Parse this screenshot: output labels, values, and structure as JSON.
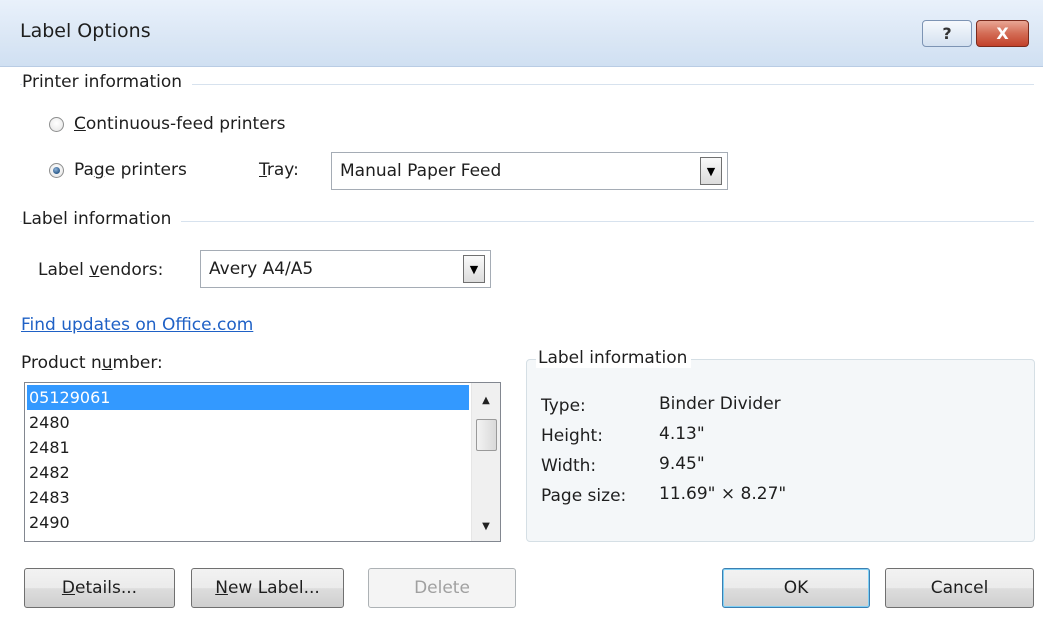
{
  "window": {
    "title": "Label Options",
    "help_label": "?",
    "close_label": "X"
  },
  "printer_info": {
    "heading": "Printer information",
    "continuous": {
      "pre": "",
      "key": "C",
      "post": "ontinuous-feed printers",
      "checked": false
    },
    "page": {
      "pre": "Pa",
      "key": "g",
      "post": "e printers",
      "checked": true
    },
    "tray_label": {
      "pre": "",
      "key": "T",
      "post": "ray:"
    },
    "tray_value": "Manual Paper Feed"
  },
  "label_info": {
    "heading": "Label information",
    "vendors_label": {
      "pre": "Label ",
      "key": "v",
      "post": "endors:"
    },
    "vendors_value": "Avery A4/A5"
  },
  "link": {
    "text": "Find updates on Office.com"
  },
  "product": {
    "label": {
      "pre": "Product n",
      "key": "u",
      "post": "mber:"
    },
    "items": [
      "05129061",
      "2480",
      "2481",
      "2482",
      "2483",
      "2490"
    ],
    "selected_index": 0
  },
  "details_box": {
    "legend": "Label information",
    "rows": [
      {
        "key": "Type:",
        "value": "Binder Divider"
      },
      {
        "key": "Height:",
        "value": "4.13\""
      },
      {
        "key": "Width:",
        "value": "9.45\""
      },
      {
        "key": "Page size:",
        "value": "11.69\" × 8.27\""
      }
    ]
  },
  "buttons": {
    "details": {
      "pre": "",
      "key": "D",
      "post": "etails..."
    },
    "new_label": {
      "pre": "",
      "key": "N",
      "post": "ew Label..."
    },
    "delete": "Delete",
    "ok": "OK",
    "cancel": "Cancel"
  },
  "icons": {
    "scroll_up": "▲",
    "scroll_down": "▼",
    "dropdown": "▼"
  }
}
